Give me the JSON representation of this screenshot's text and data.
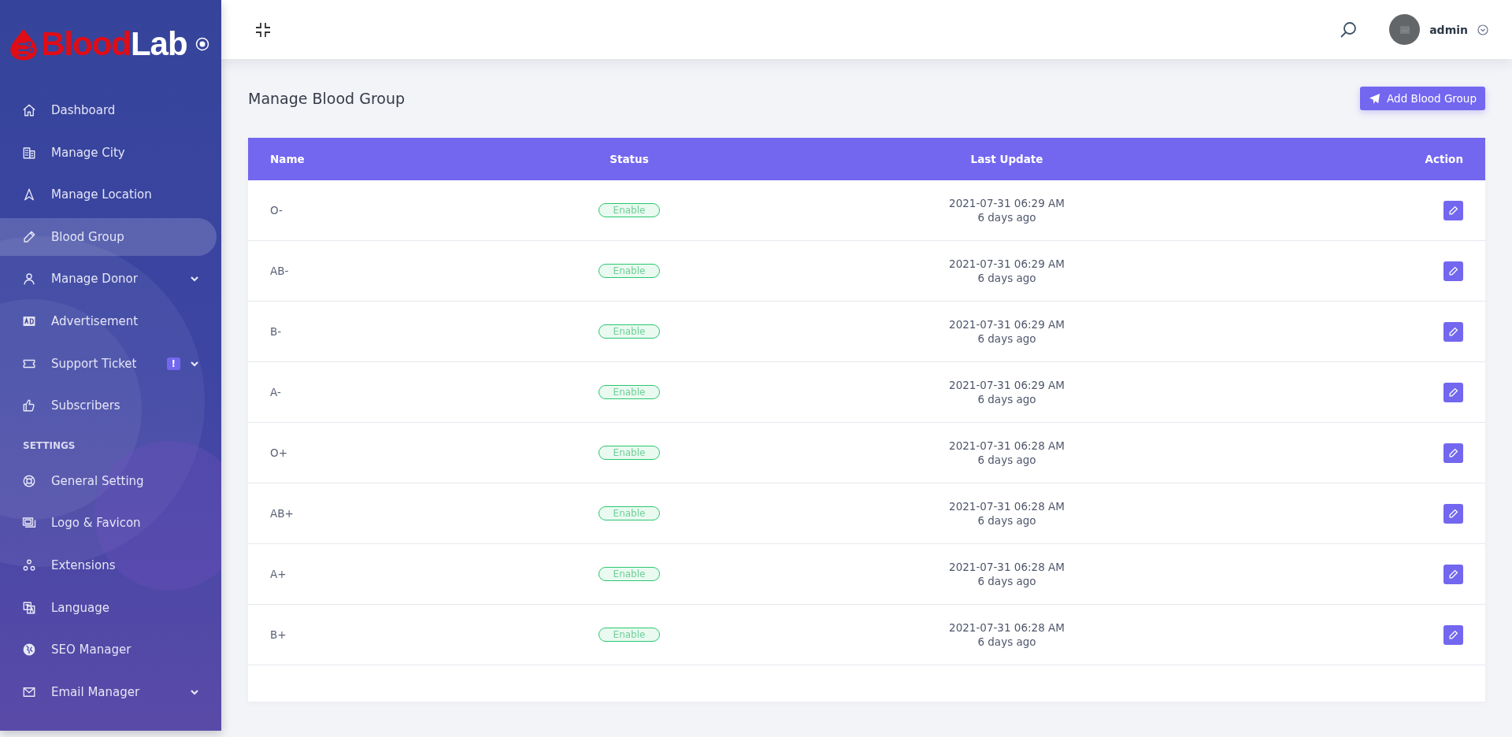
{
  "logo": {
    "part_1": "Blood",
    "part_2": "Lab"
  },
  "sidebar": {
    "sections": [
      {
        "items": [
          {
            "label": "Dashboard",
            "selected": false,
            "expandable": false
          },
          {
            "label": "Manage City",
            "selected": false,
            "expandable": false
          },
          {
            "label": "Manage Location",
            "selected": false,
            "expandable": false
          },
          {
            "label": "Blood Group",
            "selected": true,
            "expandable": false
          },
          {
            "label": "Manage Donor",
            "selected": false,
            "expandable": true
          },
          {
            "label": "Advertisement",
            "selected": false,
            "expandable": false
          },
          {
            "label": "Support Ticket",
            "selected": false,
            "expandable": true,
            "badge": "!"
          },
          {
            "label": "Subscribers",
            "selected": false,
            "expandable": false
          }
        ]
      },
      {
        "heading": "SETTINGS",
        "items": [
          {
            "label": "General Setting",
            "selected": false,
            "expandable": false
          },
          {
            "label": "Logo & Favicon",
            "selected": false,
            "expandable": false
          },
          {
            "label": "Extensions",
            "selected": false,
            "expandable": false
          },
          {
            "label": "Language",
            "selected": false,
            "expandable": false
          },
          {
            "label": "SEO Manager",
            "selected": false,
            "expandable": false
          },
          {
            "label": "Email Manager",
            "selected": false,
            "expandable": true
          }
        ]
      }
    ]
  },
  "header": {
    "user": "admin"
  },
  "page_title": "Manage Blood Group",
  "add_button": "Add Blood Group",
  "table": {
    "columns": [
      "Name",
      "Status",
      "Last Update",
      "Action"
    ],
    "rows": [
      {
        "name": "O-",
        "status": "Enable",
        "enabled": true,
        "date": "2021-07-31 06:29 AM",
        "ago": "6 days ago"
      },
      {
        "name": "AB-",
        "status": "Enable",
        "enabled": true,
        "date": "2021-07-31 06:29 AM",
        "ago": "6 days ago"
      },
      {
        "name": "B-",
        "status": "Enable",
        "enabled": true,
        "date": "2021-07-31 06:29 AM",
        "ago": "6 days ago"
      },
      {
        "name": "A-",
        "status": "Enable",
        "enabled": true,
        "date": "2021-07-31 06:29 AM",
        "ago": "6 days ago"
      },
      {
        "name": "O+",
        "status": "Enable",
        "enabled": true,
        "date": "2021-07-31 06:28 AM",
        "ago": "6 days ago"
      },
      {
        "name": "AB+",
        "status": "Enable",
        "enabled": true,
        "date": "2021-07-31 06:28 AM",
        "ago": "6 days ago"
      },
      {
        "name": "A+",
        "status": "Enable",
        "enabled": true,
        "date": "2021-07-31 06:28 AM",
        "ago": "6 days ago"
      },
      {
        "name": "B+",
        "status": "Enable",
        "enabled": true,
        "date": "2021-07-31 06:28 AM",
        "ago": "6 days ago"
      }
    ]
  }
}
